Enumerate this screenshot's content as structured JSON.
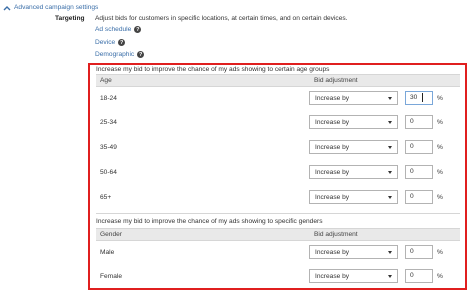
{
  "header": {
    "advanced_link": "Advanced campaign settings"
  },
  "targeting": {
    "label": "Targeting",
    "description": "Adjust bids for customers in specific locations, at certain times, and on certain devices.",
    "links": [
      "Ad schedule",
      "Device",
      "Demographic"
    ]
  },
  "age_section": {
    "title": "Increase my bid to improve the chance of my ads showing to certain age groups",
    "col_group": "Age",
    "col_adjust": "Bid adjustment",
    "rows": [
      {
        "label": "18-24",
        "mode": "Increase by",
        "value": "30"
      },
      {
        "label": "25-34",
        "mode": "Increase by",
        "value": "0"
      },
      {
        "label": "35-49",
        "mode": "Increase by",
        "value": "0"
      },
      {
        "label": "50-64",
        "mode": "Increase by",
        "value": "0"
      },
      {
        "label": "65+",
        "mode": "Increase by",
        "value": "0"
      }
    ]
  },
  "gender_section": {
    "title": "Increase my bid to improve the chance of my ads showing to specific genders",
    "col_group": "Gender",
    "col_adjust": "Bid adjustment",
    "rows": [
      {
        "label": "Male",
        "mode": "Increase by",
        "value": "0"
      },
      {
        "label": "Female",
        "mode": "Increase by",
        "value": "0"
      }
    ]
  },
  "percent_sign": "%",
  "help_icon_glyph": "?",
  "icons": {
    "expand": "chevron-up-icon",
    "help": "help-circle-icon",
    "dropdown": "dropdown-arrow-icon"
  },
  "colors": {
    "highlight_border": "#e01f1f",
    "link": "#3a6ea8",
    "table_header_bg": "#e9e9e9"
  }
}
